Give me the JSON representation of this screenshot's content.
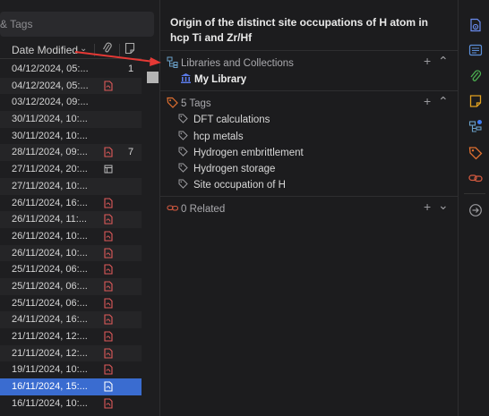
{
  "search": {
    "placeholder": "& Tags"
  },
  "columns": {
    "date_modified": "Date Modified"
  },
  "items": [
    {
      "date": "04/12/2024, 05:...",
      "attachment": "",
      "count": "1"
    },
    {
      "date": "04/12/2024, 05:...",
      "attachment": "pdf",
      "count": ""
    },
    {
      "date": "03/12/2024, 09:...",
      "attachment": "",
      "count": ""
    },
    {
      "date": "30/11/2024, 10:...",
      "attachment": "",
      "count": ""
    },
    {
      "date": "30/11/2024, 10:...",
      "attachment": "",
      "count": ""
    },
    {
      "date": "28/11/2024, 09:...",
      "attachment": "pdf",
      "count": "7"
    },
    {
      "date": "27/11/2024, 20:...",
      "attachment": "snapshot",
      "count": ""
    },
    {
      "date": "27/11/2024, 10:...",
      "attachment": "",
      "count": ""
    },
    {
      "date": "26/11/2024, 16:...",
      "attachment": "pdf",
      "count": ""
    },
    {
      "date": "26/11/2024, 11:...",
      "attachment": "pdf",
      "count": ""
    },
    {
      "date": "26/11/2024, 10:...",
      "attachment": "pdf",
      "count": ""
    },
    {
      "date": "26/11/2024, 10:...",
      "attachment": "pdf",
      "count": ""
    },
    {
      "date": "25/11/2024, 06:...",
      "attachment": "pdf",
      "count": ""
    },
    {
      "date": "25/11/2024, 06:...",
      "attachment": "pdf",
      "count": ""
    },
    {
      "date": "25/11/2024, 06:...",
      "attachment": "pdf",
      "count": ""
    },
    {
      "date": "24/11/2024, 16:...",
      "attachment": "pdf",
      "count": ""
    },
    {
      "date": "21/11/2024, 12:...",
      "attachment": "pdf",
      "count": ""
    },
    {
      "date": "21/11/2024, 12:...",
      "attachment": "pdf",
      "count": ""
    },
    {
      "date": "19/11/2024, 10:...",
      "attachment": "pdf",
      "count": ""
    },
    {
      "date": "16/11/2024, 15:...",
      "attachment": "pdf",
      "count": "",
      "selected": true
    },
    {
      "date": "16/11/2024, 10:...",
      "attachment": "pdf",
      "count": ""
    }
  ],
  "item_pane": {
    "title": "Origin of the distinct site occupations of H atom in hcp Ti and Zr/Hf",
    "libraries": {
      "heading": "Libraries and Collections",
      "library": "My Library"
    },
    "tags": {
      "heading": "5 Tags",
      "list": [
        "DFT calculations",
        "hcp metals",
        "Hydrogen embrittlement",
        "Hydrogen storage",
        "Site occupation of H"
      ]
    },
    "related": {
      "heading": "0 Related"
    }
  },
  "sidenav": [
    "info-icon",
    "abstract-icon",
    "attachments-icon",
    "notes-icon",
    "libraries-collections-icon",
    "tags-icon",
    "related-icon",
    "locate-icon"
  ],
  "colors": {
    "accent": "#3a6cd0",
    "pdf": "#e05a5a",
    "tag": "#e07030",
    "arrow": "#e53935"
  }
}
